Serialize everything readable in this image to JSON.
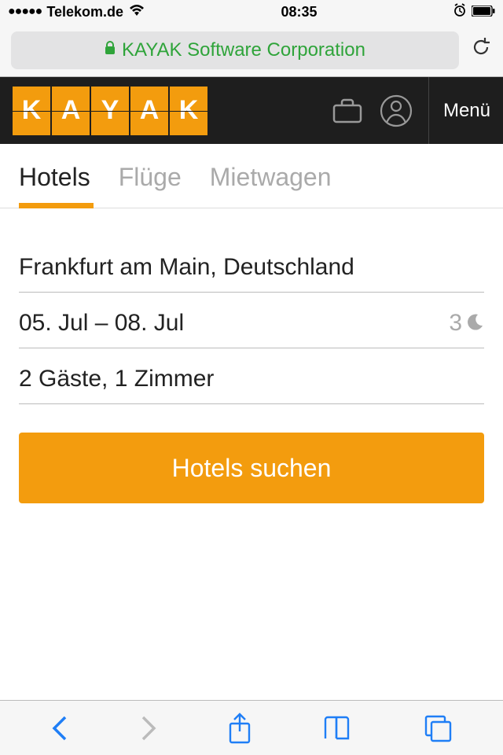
{
  "status_bar": {
    "carrier": "Telekom.de",
    "time": "08:35"
  },
  "browser": {
    "url_label": "KAYAK Software Corporation"
  },
  "logo_letters": [
    "K",
    "A",
    "Y",
    "A",
    "K"
  ],
  "header": {
    "menu_label": "Menü"
  },
  "tabs": {
    "hotels": "Hotels",
    "flights": "Flüge",
    "cars": "Mietwagen"
  },
  "form": {
    "destination": "Frankfurt am Main, Deutschland",
    "dates": "05. Jul – 08. Jul",
    "nights": "3",
    "guests": "2 Gäste, 1 Zimmer",
    "search_label": "Hotels suchen"
  }
}
